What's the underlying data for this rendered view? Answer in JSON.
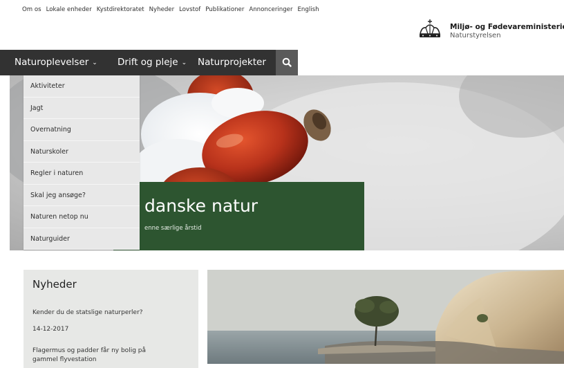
{
  "top_links": [
    "Om os",
    "Lokale enheder",
    "Kystdirektoratet",
    "Nyheder",
    "Lovstof",
    "Publikationer",
    "Annonceringer",
    "English"
  ],
  "brand": {
    "name": "Miljø- og Fødevareministeriet",
    "sub": "Naturstyrelsen"
  },
  "nav": {
    "items": [
      {
        "label": "Naturoplevelser",
        "chevron": "⌄"
      },
      {
        "label": "Drift og pleje",
        "chevron": "⌄"
      },
      {
        "label": "Naturprojekter",
        "chevron": ""
      }
    ],
    "search_icon": "search-icon"
  },
  "dropdown": [
    "Aktiviteter",
    "Jagt",
    "Overnatning",
    "Naturskoler",
    "Regler i naturen",
    "Skal jeg ansøge?",
    "Naturen netop nu",
    "Naturguider"
  ],
  "hero": {
    "title": "danske natur",
    "subtitle": "enne særlige årstid"
  },
  "news": {
    "heading": "Nyheder",
    "items": [
      {
        "text": "Kender du de statslige naturperler?",
        "date": "14-12-2017"
      },
      {
        "text": "Flagermus og padder får ny bolig på gammel flyvestation"
      }
    ]
  },
  "colors": {
    "nav_bg": "#323232",
    "hero_card": "#2d5530",
    "dropdown_bg": "#e8e8e8",
    "news_bg": "#e7e8e6"
  }
}
